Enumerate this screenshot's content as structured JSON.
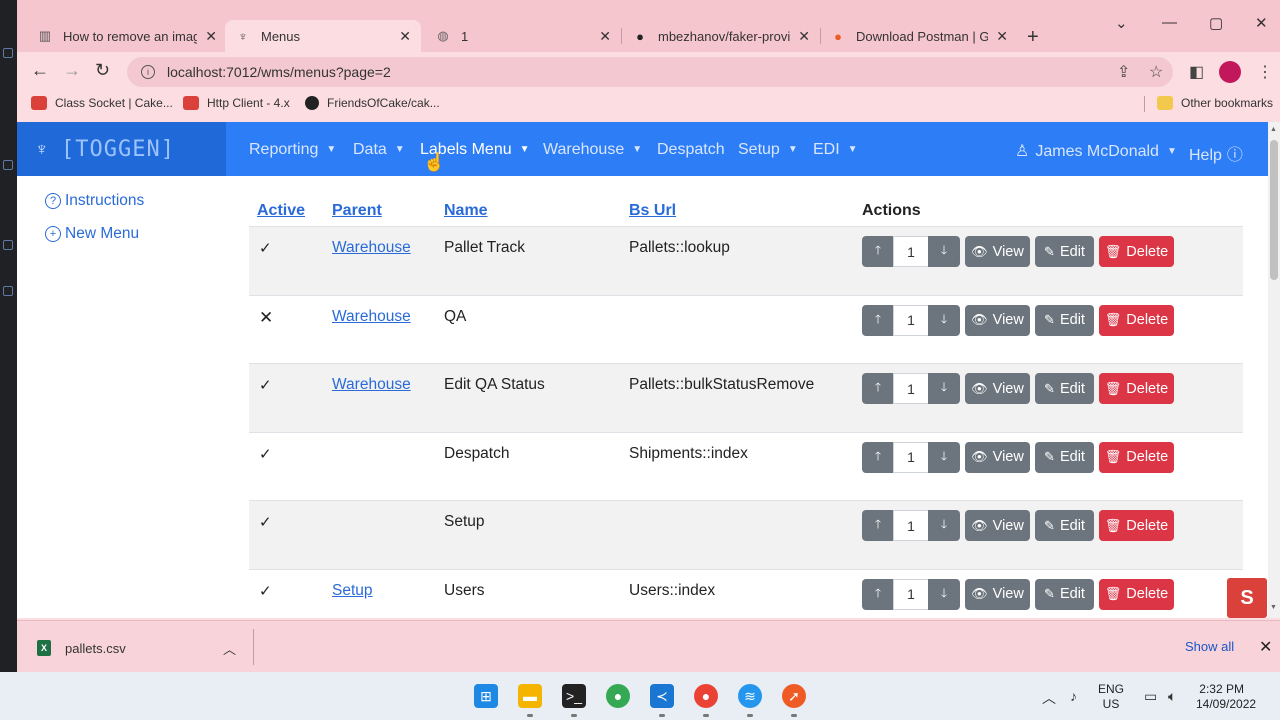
{
  "browser": {
    "tabs": [
      {
        "title": "How to remove an image",
        "icon": "chart-icon",
        "active": false
      },
      {
        "title": "Menus",
        "icon": "toggen-icon",
        "active": true
      },
      {
        "title": "1",
        "icon": "globe-icon",
        "active": false
      },
      {
        "title": "mbezhanov/faker-provid",
        "icon": "github-icon",
        "active": false
      },
      {
        "title": "Download Postman | Get",
        "icon": "postman-icon",
        "active": false
      }
    ],
    "url": "localhost:7012/wms/menus?page=2",
    "bookmarks": [
      {
        "label": "Class Socket | Cake...",
        "icon": "cake-icon",
        "color": "#d9413a"
      },
      {
        "label": "Http Client - 4.x",
        "icon": "cake-icon",
        "color": "#d9413a"
      },
      {
        "label": "FriendsOfCake/cak...",
        "icon": "github-icon",
        "color": "#222222"
      }
    ],
    "other_bookmarks": "Other bookmarks"
  },
  "app": {
    "brand": "[TOGGEN]",
    "nav": [
      {
        "label": "Reporting",
        "dropdown": true
      },
      {
        "label": "Data",
        "dropdown": true
      },
      {
        "label": "Labels Menu",
        "dropdown": true
      },
      {
        "label": "Warehouse",
        "dropdown": true
      },
      {
        "label": "Despatch",
        "dropdown": false
      },
      {
        "label": "Setup",
        "dropdown": true
      },
      {
        "label": "EDI",
        "dropdown": true
      }
    ],
    "user": "James McDonald",
    "help": "Help",
    "sidebar": [
      {
        "label": "Instructions",
        "icon": "question-circle-icon"
      },
      {
        "label": "New Menu",
        "icon": "plus-circle-icon"
      }
    ]
  },
  "table": {
    "headers": {
      "active": "Active",
      "parent": "Parent",
      "name": "Name",
      "bs_url": "Bs Url",
      "actions": "Actions"
    },
    "buttons": {
      "view": "View",
      "edit": "Edit",
      "delete": "Delete"
    },
    "rows": [
      {
        "active": "✓",
        "parent": "Warehouse",
        "name": "Pallet Track",
        "bs_url": "Pallets::lookup",
        "order": "1"
      },
      {
        "active": "✕",
        "parent": "Warehouse",
        "name": "QA",
        "bs_url": "",
        "order": "1"
      },
      {
        "active": "✓",
        "parent": "Warehouse",
        "name": "Edit QA Status",
        "bs_url": "Pallets::bulkStatusRemove",
        "order": "1"
      },
      {
        "active": "✓",
        "parent": "",
        "name": "Despatch",
        "bs_url": "Shipments::index",
        "order": "1"
      },
      {
        "active": "✓",
        "parent": "",
        "name": "Setup",
        "bs_url": "",
        "order": "1"
      },
      {
        "active": "✓",
        "parent": "Setup",
        "name": "Users",
        "bs_url": "Users::index",
        "order": "1"
      }
    ]
  },
  "downloads": {
    "file": "pallets.csv",
    "show_all": "Show all"
  },
  "taskbar": {
    "lang1": "ENG",
    "lang2": "US",
    "time": "2:32 PM",
    "date": "14/09/2022"
  },
  "colors": {
    "navbar": "#2d7df6",
    "link": "#2a6bd8",
    "danger": "#dc3545",
    "secondary": "#6c757d",
    "chrome_theme": "#f6c6cf"
  }
}
